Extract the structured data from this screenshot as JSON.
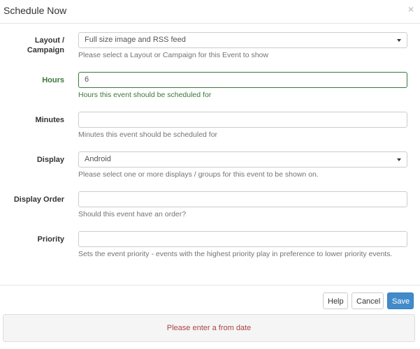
{
  "header": {
    "title": "Schedule Now",
    "close_symbol": "×",
    "close_icon": "close-icon"
  },
  "form": {
    "layout_campaign": {
      "label_line1": "Layout /",
      "label_line2": "Campaign",
      "value": "Full size image and RSS feed",
      "help": "Please select a Layout or Campaign for this Event to show",
      "icon": "caret-down-icon"
    },
    "hours": {
      "label": "Hours",
      "value": "6",
      "help": "Hours this event should be scheduled for",
      "state_color": "#3c763d"
    },
    "minutes": {
      "label": "Minutes",
      "value": "",
      "help": "Minutes this event should be scheduled for"
    },
    "display": {
      "label": "Display",
      "value": "Android",
      "help": "Please select one or more displays / groups for this event to be shown on.",
      "icon": "caret-down-icon"
    },
    "display_order": {
      "label": "Display Order",
      "value": "",
      "help": "Should this event have an order?"
    },
    "priority": {
      "label": "Priority",
      "value": "",
      "help": "Sets the event priority - events with the highest priority play in preference to lower priority events."
    }
  },
  "footer": {
    "help_label": "Help",
    "cancel_label": "Cancel",
    "save_label": "Save",
    "primary_color": "#428bca"
  },
  "alert": {
    "message": "Please enter a from date",
    "color": "#a94442"
  }
}
